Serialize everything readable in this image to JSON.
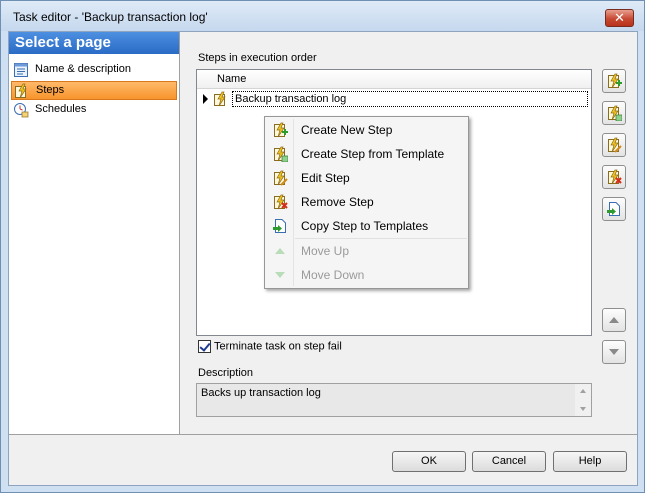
{
  "window": {
    "title": "Task editor - 'Backup transaction log'",
    "close_glyph": "✕"
  },
  "sidebar": {
    "header": "Select a page",
    "items": [
      {
        "label": "Name & description",
        "icon": "document-icon",
        "selected": false
      },
      {
        "label": "Steps",
        "icon": "lightning-steps-icon",
        "selected": true
      },
      {
        "label": "Schedules",
        "icon": "clock-icon",
        "selected": false
      }
    ]
  },
  "steps": {
    "section_label": "Steps in execution order",
    "column_name": "Name",
    "rows": [
      {
        "name": "Backup transaction log",
        "current": true
      }
    ]
  },
  "context_menu": {
    "items": [
      {
        "label": "Create New Step",
        "icon": "create-step-icon",
        "enabled": true
      },
      {
        "label": "Create Step from Template",
        "icon": "create-from-template-icon",
        "enabled": true
      },
      {
        "label": "Edit Step",
        "icon": "edit-step-icon",
        "enabled": true
      },
      {
        "label": "Remove Step",
        "icon": "remove-step-icon",
        "enabled": true
      },
      {
        "label": "Copy Step to Templates",
        "icon": "copy-to-templates-icon",
        "enabled": true
      },
      {
        "label": "Move Up",
        "icon": "arrow-up-icon",
        "enabled": false
      },
      {
        "label": "Move Down",
        "icon": "arrow-down-icon",
        "enabled": false
      }
    ]
  },
  "options": {
    "terminate_label": "Terminate task on step fail",
    "terminate_checked": true
  },
  "description": {
    "label": "Description",
    "value": "Backs up transaction log"
  },
  "buttons": {
    "ok": "OK",
    "cancel": "Cancel",
    "help": "Help"
  },
  "colors": {
    "sidebar_header": "#2a6bc6",
    "selected_item": "#f7942d",
    "titlebar": "#cfe0f3"
  }
}
